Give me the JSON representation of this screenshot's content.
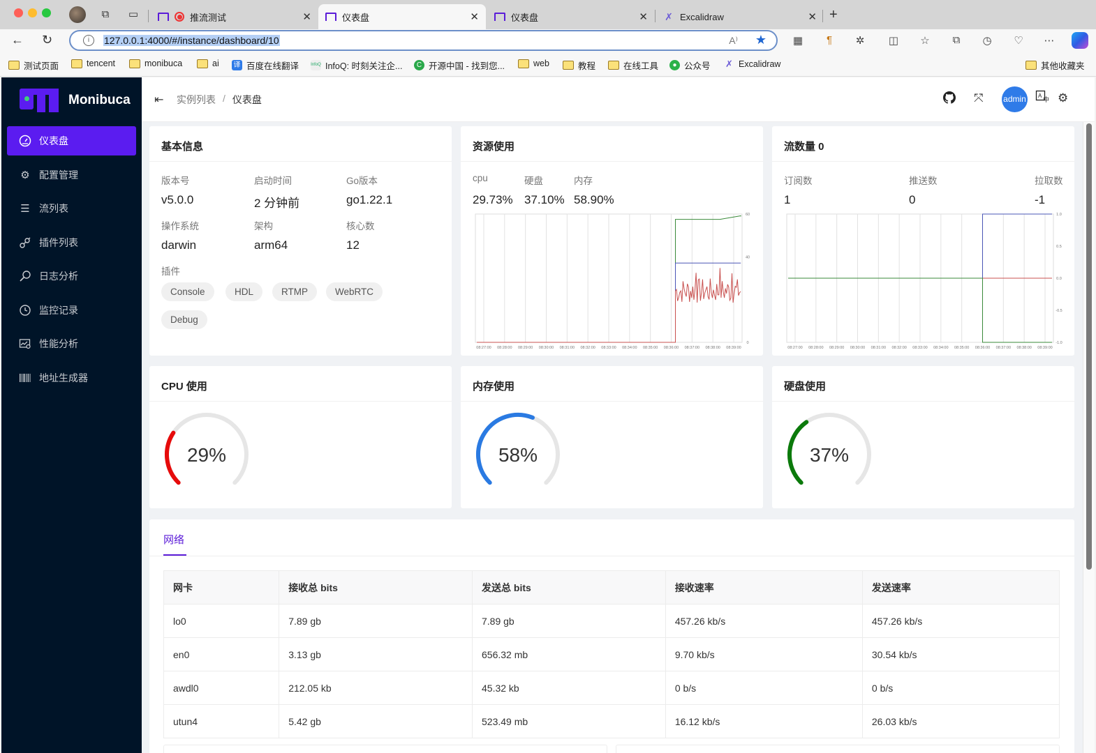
{
  "browser": {
    "tabs": [
      {
        "label": "推流测试",
        "favicon": "monibuca-icon",
        "recording": true,
        "active": false
      },
      {
        "label": "仪表盘",
        "favicon": "monibuca-icon",
        "active": true
      },
      {
        "label": "仪表盘",
        "favicon": "monibuca-icon",
        "active": false
      },
      {
        "label": "Excalidraw",
        "favicon": "excalidraw-icon",
        "active": false
      }
    ],
    "url": "127.0.0.1:4000/#/instance/dashboard/10",
    "bookmarks": [
      {
        "label": "测试页面",
        "icon": "folder-icon"
      },
      {
        "label": "tencent",
        "icon": "folder-icon"
      },
      {
        "label": "monibuca",
        "icon": "folder-icon"
      },
      {
        "label": "ai",
        "icon": "folder-icon"
      },
      {
        "label": "百度在线翻译",
        "icon": "translate-icon"
      },
      {
        "label": "InfoQ: 时刻关注企...",
        "icon": "infoq-icon"
      },
      {
        "label": "开源中国 - 找到您...",
        "icon": "oschina-icon"
      },
      {
        "label": "web",
        "icon": "folder-icon"
      },
      {
        "label": "教程",
        "icon": "folder-icon"
      },
      {
        "label": "在线工具",
        "icon": "folder-icon"
      },
      {
        "label": "公众号",
        "icon": "wechat-icon"
      },
      {
        "label": "Excalidraw",
        "icon": "excalidraw-icon"
      }
    ],
    "other_bookmarks": "其他收藏夹"
  },
  "app": {
    "name": "Monibuca",
    "menu": [
      {
        "label": "仪表盘",
        "icon": "dashboard-icon",
        "active": true
      },
      {
        "label": "配置管理",
        "icon": "gear-icon"
      },
      {
        "label": "流列表",
        "icon": "list-icon"
      },
      {
        "label": "插件列表",
        "icon": "plug-icon"
      },
      {
        "label": "日志分析",
        "icon": "log-search-icon"
      },
      {
        "label": "监控记录",
        "icon": "history-icon"
      },
      {
        "label": "性能分析",
        "icon": "performance-icon"
      },
      {
        "label": "地址生成器",
        "icon": "barcode-icon"
      }
    ],
    "breadcrumb": [
      "实例列表",
      "仪表盘"
    ],
    "header": {
      "avatar": "admin"
    }
  },
  "basic_info": {
    "title": "基本信息",
    "fields": [
      {
        "label": "版本号",
        "value": "v5.0.0"
      },
      {
        "label": "启动时间",
        "value": "2 分钟前"
      },
      {
        "label": "Go版本",
        "value": "go1.22.1"
      },
      {
        "label": "操作系统",
        "value": "darwin"
      },
      {
        "label": "架构",
        "value": "arm64"
      },
      {
        "label": "核心数",
        "value": "12"
      }
    ],
    "plugins_label": "插件",
    "plugins": [
      "Console",
      "HDL",
      "RTMP",
      "WebRTC",
      "Debug"
    ]
  },
  "resource": {
    "title": "资源使用",
    "stats": [
      {
        "label": "cpu",
        "value": "29.73%"
      },
      {
        "label": "硬盘",
        "value": "37.10%"
      },
      {
        "label": "内存",
        "value": "58.90%"
      }
    ]
  },
  "streams": {
    "title": "流数量 0",
    "stats": [
      {
        "label": "订阅数",
        "value": "1"
      },
      {
        "label": "推送数",
        "value": "0"
      },
      {
        "label": "拉取数",
        "value": "-1"
      }
    ]
  },
  "gauges": [
    {
      "title": "CPU 使用",
      "value": 29,
      "label": "29%",
      "color": "#e60b0b"
    },
    {
      "title": "内存使用",
      "value": 58,
      "label": "58%",
      "color": "#2a7ae2"
    },
    {
      "title": "硬盘使用",
      "value": 37,
      "label": "37%",
      "color": "#0b7a0b"
    }
  ],
  "network": {
    "tab": "网络",
    "columns": [
      "网卡",
      "接收总 bits",
      "发送总 bits",
      "接收速率",
      "发送速率"
    ],
    "rows": [
      [
        "lo0",
        "7.89 gb",
        "7.89 gb",
        "457.26 kb/s",
        "457.26 kb/s"
      ],
      [
        "en0",
        "3.13 gb",
        "656.32 mb",
        "9.70 kb/s",
        "30.54 kb/s"
      ],
      [
        "awdl0",
        "212.05 kb",
        "45.32 kb",
        "0 b/s",
        "0 b/s"
      ],
      [
        "utun4",
        "5.42 gb",
        "523.49 mb",
        "16.12 kb/s",
        "26.03 kb/s"
      ]
    ]
  },
  "chart_data": [
    {
      "type": "line",
      "title": "资源使用",
      "x": [
        "08:27:00",
        "08:28:00",
        "08:29:00",
        "08:30:00",
        "08:31:00",
        "08:32:00",
        "08:33:00",
        "08:34:00",
        "08:35:00",
        "08:36:00",
        "08:37:00",
        "08:38:00",
        "08:39:00"
      ],
      "ylim": [
        0,
        60
      ],
      "yticks": [
        "0",
        "40",
        "60"
      ],
      "grid": true,
      "series": [
        {
          "name": "内存",
          "color": "#3a8a3a",
          "values": [
            0,
            0,
            0,
            0,
            0,
            0,
            0,
            0,
            0,
            0,
            57.5,
            59.2,
            58.9
          ]
        },
        {
          "name": "硬盘",
          "color": "#4a55b5",
          "values": [
            0,
            0,
            0,
            0,
            0,
            0,
            0,
            0,
            0,
            0,
            37.1,
            37.1,
            37.1
          ]
        },
        {
          "name": "cpu",
          "color": "#c8504f",
          "values": [
            0,
            0,
            0,
            0,
            0,
            0,
            0,
            0,
            0,
            0,
            22,
            25,
            29.7
          ]
        }
      ]
    },
    {
      "type": "line",
      "title": "流数量",
      "x": [
        "08:27:00",
        "08:28:00",
        "08:29:00",
        "08:30:00",
        "08:31:00",
        "08:32:00",
        "08:33:00",
        "08:34:00",
        "08:35:00",
        "08:36:00",
        "08:37:00",
        "08:38:00",
        "08:39:00"
      ],
      "ylim": [
        -1,
        1
      ],
      "yticks": [
        "1.0",
        "0.5",
        "0.0",
        "-0.5",
        "-1.0"
      ],
      "grid": true,
      "series": [
        {
          "name": "订阅数",
          "color": "#4a55b5",
          "values": [
            0,
            0,
            0,
            0,
            0,
            0,
            0,
            0,
            0,
            1,
            1,
            1,
            1
          ]
        },
        {
          "name": "推送数",
          "color": "#c8504f",
          "values": [
            0,
            0,
            0,
            0,
            0,
            0,
            0,
            0,
            0,
            0,
            0,
            0,
            0
          ]
        },
        {
          "name": "拉取数",
          "color": "#3a8a3a",
          "values": [
            0,
            0,
            0,
            0,
            0,
            0,
            0,
            0,
            0,
            -1,
            -1,
            -1,
            -1
          ]
        }
      ]
    }
  ]
}
